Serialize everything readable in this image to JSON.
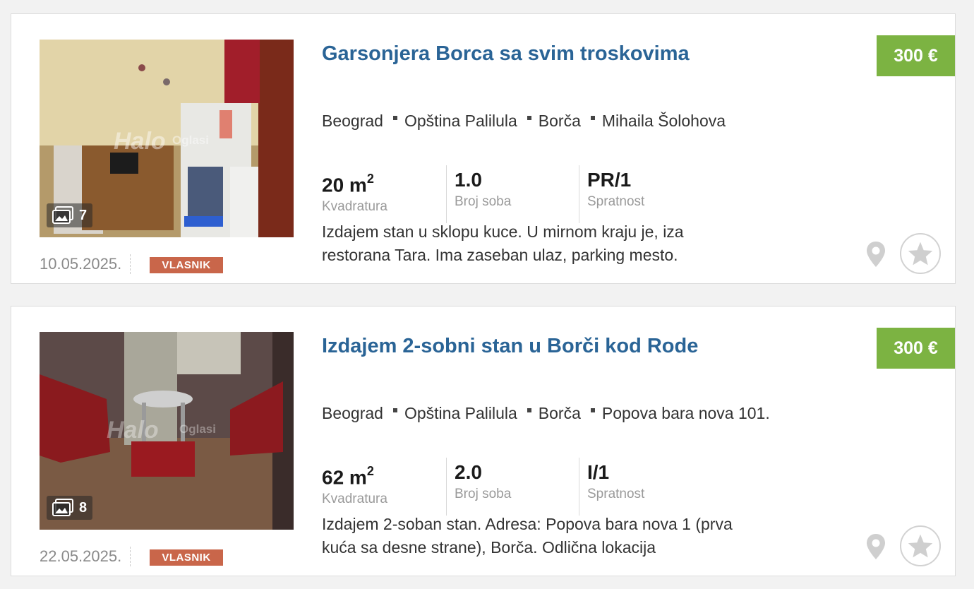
{
  "listings": [
    {
      "title": "Garsonjera Borca sa svim troskovima",
      "price": "300 €",
      "location": [
        "Beograd",
        "Opština Palilula",
        "Borča",
        "Mihaila Šolohova"
      ],
      "features": [
        {
          "value": "20 m",
          "sup": "2",
          "label": "Kvadratura"
        },
        {
          "value": "1.0",
          "sup": "",
          "label": "Broj soba"
        },
        {
          "value": "PR/1",
          "sup": "",
          "label": "Spratnost"
        }
      ],
      "description": "Izdajem stan u sklopu kuce. U mirnom kraju je, iza restorana Tara. Ima zaseban ulaz, parking mesto.",
      "photo_count": "7",
      "date": "10.05.2025.",
      "badge": "VLASNIK"
    },
    {
      "title": "Izdajem 2-sobni stan u Borči kod Rode",
      "price": "300 €",
      "location": [
        "Beograd",
        "Opština Palilula",
        "Borča",
        "Popova bara nova 101."
      ],
      "features": [
        {
          "value": "62 m",
          "sup": "2",
          "label": "Kvadratura"
        },
        {
          "value": "2.0",
          "sup": "",
          "label": "Broj soba"
        },
        {
          "value": "I/1",
          "sup": "",
          "label": "Spratnost"
        }
      ],
      "description": "Izdajem 2-soban stan. Adresa: Popova bara nova 1 (prva kuća sa desne strane), Borča. Odlična lokacija",
      "photo_count": "8",
      "date": "22.05.2025.",
      "badge": "VLASNIK"
    }
  ],
  "colors": {
    "title": "#2a6496",
    "price_bg": "#7cb342",
    "badge_bg": "#c9664a"
  },
  "icons": {
    "photo_count": "images-icon",
    "map": "map-pin-icon",
    "favorite": "star-icon"
  }
}
